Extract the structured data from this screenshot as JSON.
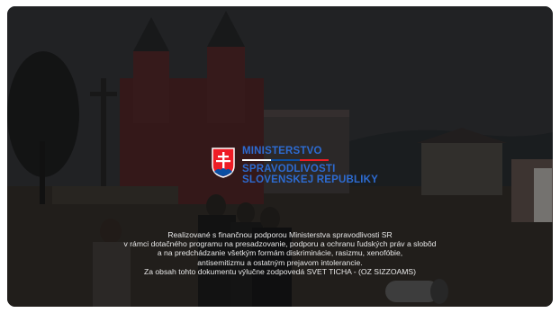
{
  "logo": {
    "icon": "slovak-coat-of-arms-icon",
    "line1": "MINISTERSTVO",
    "line2": "SPRAVODLIVOSTI",
    "line3": "SLOVENSKEJ REPUBLIKY",
    "brand_color": "#2d6bd1",
    "flag_colors": [
      "#ffffff",
      "#0b4ea2",
      "#ee1c25"
    ]
  },
  "credit_lines": [
    "Realizované s finančnou podporou Ministerstva spravodlivosti SR",
    "v rámci dotačného programu na presadzovanie, podporu a ochranu ľudských práv a slobôd",
    "a na predchádzanie všetkým formám diskriminácie, rasizmu, xenofóbie,",
    "antisemitizmu a ostatným prejavom intolerancie.",
    "Za obsah tohto dokumentu výlučne zodpovedá SVET TICHA - (OZ SIZZOAMS)"
  ]
}
